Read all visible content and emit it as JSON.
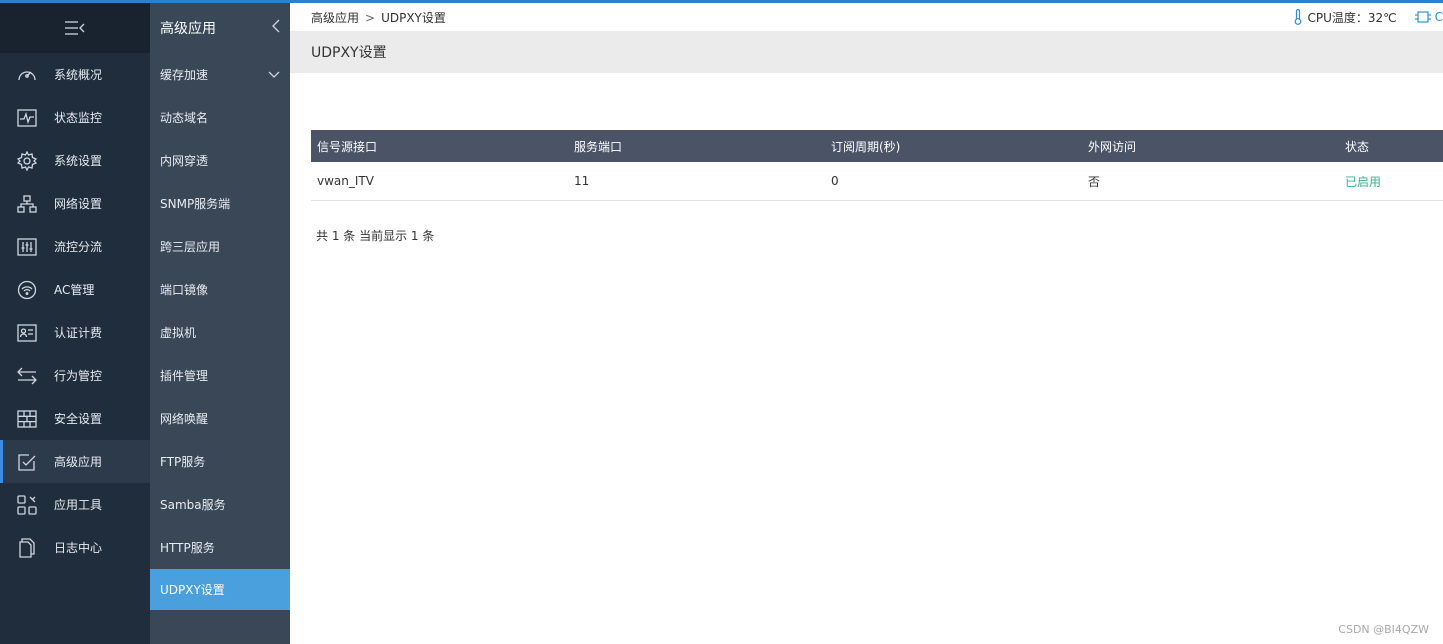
{
  "nav1": {
    "menu_toggle_icon": "menu-collapse-icon",
    "items": [
      {
        "label": "系统概况",
        "icon": "dashboard-icon"
      },
      {
        "label": "状态监控",
        "icon": "monitor-pulse-icon"
      },
      {
        "label": "系统设置",
        "icon": "gear-icon"
      },
      {
        "label": "网络设置",
        "icon": "network-tree-icon"
      },
      {
        "label": "流控分流",
        "icon": "sliders-icon"
      },
      {
        "label": "AC管理",
        "icon": "wifi-ap-icon"
      },
      {
        "label": "认证计费",
        "icon": "id-card-icon"
      },
      {
        "label": "行为管控",
        "icon": "swap-arrows-icon"
      },
      {
        "label": "安全设置",
        "icon": "firewall-icon"
      },
      {
        "label": "高级应用",
        "icon": "checked-box-icon",
        "active": true
      },
      {
        "label": "应用工具",
        "icon": "apps-grid-icon"
      },
      {
        "label": "日志中心",
        "icon": "documents-icon"
      }
    ]
  },
  "nav2": {
    "title": "高级应用",
    "items": [
      {
        "label": "缓存加速",
        "has_chevron": true
      },
      {
        "label": "动态域名"
      },
      {
        "label": "内网穿透"
      },
      {
        "label": "SNMP服务端"
      },
      {
        "label": "跨三层应用"
      },
      {
        "label": "端口镜像"
      },
      {
        "label": "虚拟机"
      },
      {
        "label": "插件管理"
      },
      {
        "label": "网络唤醒"
      },
      {
        "label": "FTP服务"
      },
      {
        "label": "Samba服务"
      },
      {
        "label": "HTTP服务"
      },
      {
        "label": "UDPXY设置",
        "active": true
      }
    ]
  },
  "breadcrumb": {
    "parent": "高级应用",
    "separator": ">",
    "current": "UDPXY设置"
  },
  "sysinfo": {
    "cpu_temp": "CPU温度：32℃",
    "cpu_partial": "C"
  },
  "page_title": "UDPXY设置",
  "table": {
    "headers": [
      "信号源接口",
      "服务端口",
      "订阅周期(秒)",
      "外网访问",
      "状态"
    ],
    "rows": [
      {
        "interface": "vwan_ITV",
        "port": "11",
        "period": "0",
        "external": "否",
        "status": "已启用"
      }
    ]
  },
  "summary": "共 1 条 当前显示 1 条",
  "watermark": "CSDN @BI4QZW",
  "colors": {
    "accent": "#4aa0dd",
    "status_enabled": "#3ab08a",
    "table_header": "#4a5466",
    "sidebar": "#1f2d3d"
  }
}
